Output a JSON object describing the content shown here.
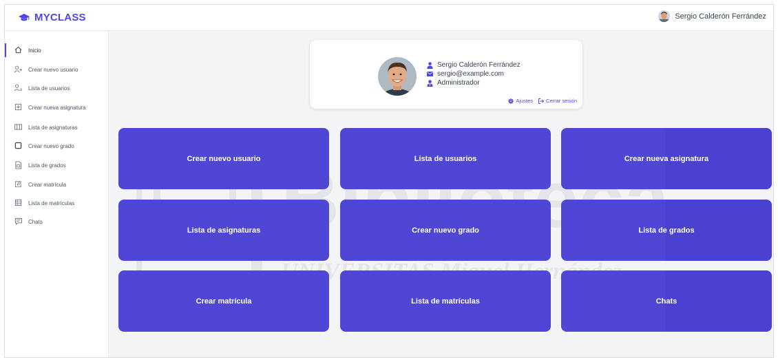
{
  "app": {
    "brand": "MYCLASS",
    "accent": "#4f46e5"
  },
  "header": {
    "user_name": "Sergio Calderón Ferrández",
    "avatar": "user-avatar"
  },
  "sidebar": {
    "items": [
      {
        "label": "Inicio",
        "icon": "home-icon",
        "active": true
      },
      {
        "label": "Crear nuevo usuario",
        "icon": "user-plus-icon"
      },
      {
        "label": "Lista de usuarios",
        "icon": "users-icon"
      },
      {
        "label": "Crear nueva asignatura",
        "icon": "add-box-icon"
      },
      {
        "label": "Lista de asignaturas",
        "icon": "list-icon"
      },
      {
        "label": "Crear nuevo grado",
        "icon": "folder-icon"
      },
      {
        "label": "Lista de grados",
        "icon": "document-icon"
      },
      {
        "label": "Crear matrícula",
        "icon": "edit-icon"
      },
      {
        "label": "Lista de matrículas",
        "icon": "table-icon"
      },
      {
        "label": "Chats",
        "icon": "chat-icon"
      }
    ]
  },
  "profile": {
    "name": "Sergio Calderón Ferrández",
    "email": "sergio@example.com",
    "role": "Administrador",
    "settings_label": "Ajustes",
    "logout_label": "Cerrar sesión"
  },
  "tiles": [
    "Crear nuevo usuario",
    "Lista de usuarios",
    "Crear nueva asignatura",
    "Lista de asignaturas",
    "Crear nuevo grado",
    "Lista de grados",
    "Crear matrícula",
    "Lista de matrículas",
    "Chats"
  ],
  "watermark": {
    "line1": "Biblioteca",
    "line2": "UNIVERSITAS Miguel Hernández"
  }
}
